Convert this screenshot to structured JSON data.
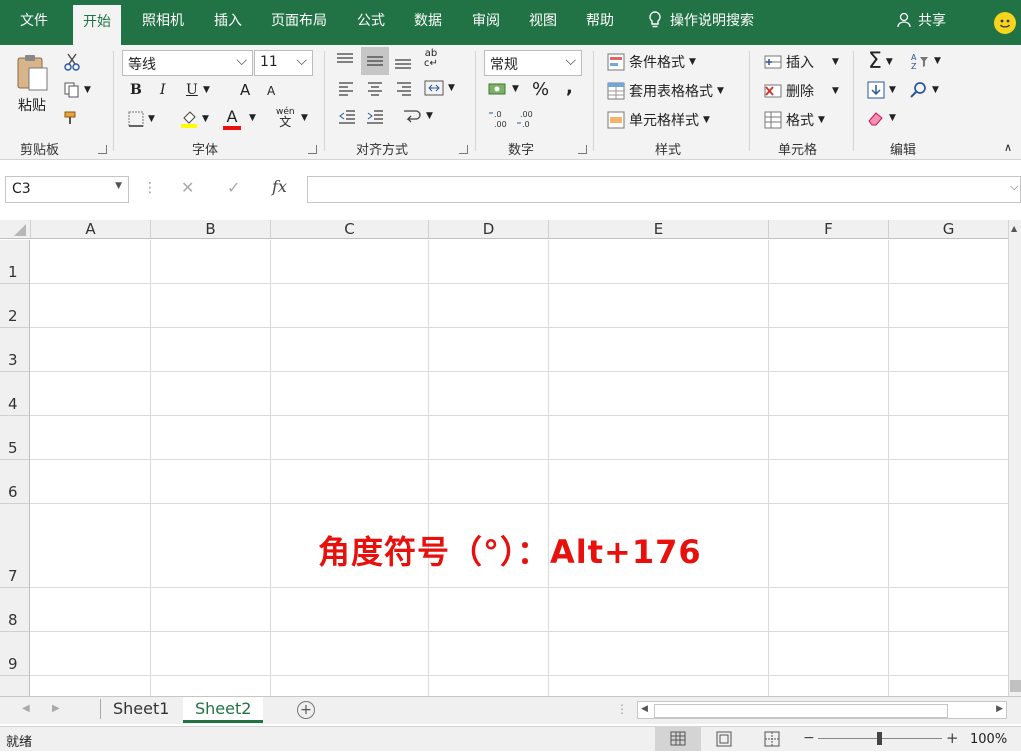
{
  "tabs": [
    "文件",
    "开始",
    "照相机",
    "插入",
    "页面布局",
    "公式",
    "数据",
    "审阅",
    "视图",
    "帮助"
  ],
  "active_tab": "开始",
  "tell_me": "操作说明搜索",
  "share": "共享",
  "clipboard": {
    "paste": "粘贴",
    "group": "剪贴板"
  },
  "font": {
    "name": "等线",
    "size": "11",
    "group": "字体",
    "bold": "B",
    "italic": "I",
    "underline": "U",
    "grow": "A",
    "shrink": "A",
    "color_a": "A",
    "phonetic_top": "wén",
    "phonetic_bottom": "文"
  },
  "alignment": {
    "group": "对齐方式"
  },
  "number": {
    "format": "常规",
    "percent": "%",
    "comma": ",",
    "group": "数字"
  },
  "styles": {
    "conditional": "条件格式",
    "table": "套用表格格式",
    "cell": "单元格样式",
    "group": "样式"
  },
  "cells": {
    "insert": "插入",
    "delete": "删除",
    "format": "格式",
    "group": "单元格"
  },
  "editing": {
    "group": "编辑",
    "sigma": "Σ"
  },
  "formula_bar": {
    "name_box": "C3",
    "fx": "fx",
    "cancel": "✕",
    "enter": "✓",
    "value": ""
  },
  "columns": [
    "A",
    "B",
    "C",
    "D",
    "E",
    "F",
    "G"
  ],
  "rows": [
    "1",
    "2",
    "3",
    "4",
    "5",
    "6",
    "7",
    "8",
    "9"
  ],
  "overlay": "角度符号（°）：Alt+176",
  "sheets": [
    "Sheet1",
    "Sheet2"
  ],
  "active_sheet": "Sheet2",
  "status": {
    "ready": "就绪",
    "zoom": "100%"
  },
  "colors": {
    "accent": "#217346",
    "overlay": "#e8100c"
  }
}
